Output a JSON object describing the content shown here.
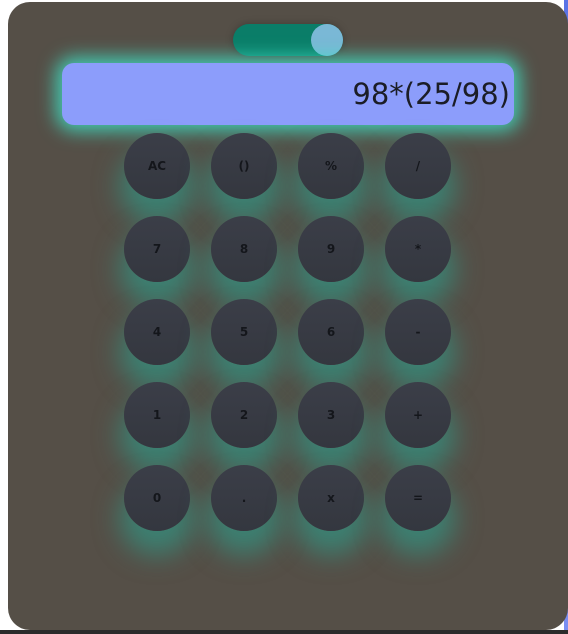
{
  "display": {
    "expression": "98*(25/98)"
  },
  "theme_toggle": {
    "state": "on"
  },
  "keypad": {
    "rows": [
      [
        "AC",
        "()",
        "%",
        "/"
      ],
      [
        "7",
        "8",
        "9",
        "*"
      ],
      [
        "4",
        "5",
        "6",
        "-"
      ],
      [
        "1",
        "2",
        "3",
        "+"
      ],
      [
        "0",
        ".",
        "x",
        "="
      ]
    ]
  },
  "colors": {
    "background": "#554f47",
    "display": "#8c9dfb",
    "glow": "#40e0c4",
    "key": "#3a3d47",
    "toggle_track": "#0a7d68",
    "toggle_knob": "#7ab8d6"
  }
}
